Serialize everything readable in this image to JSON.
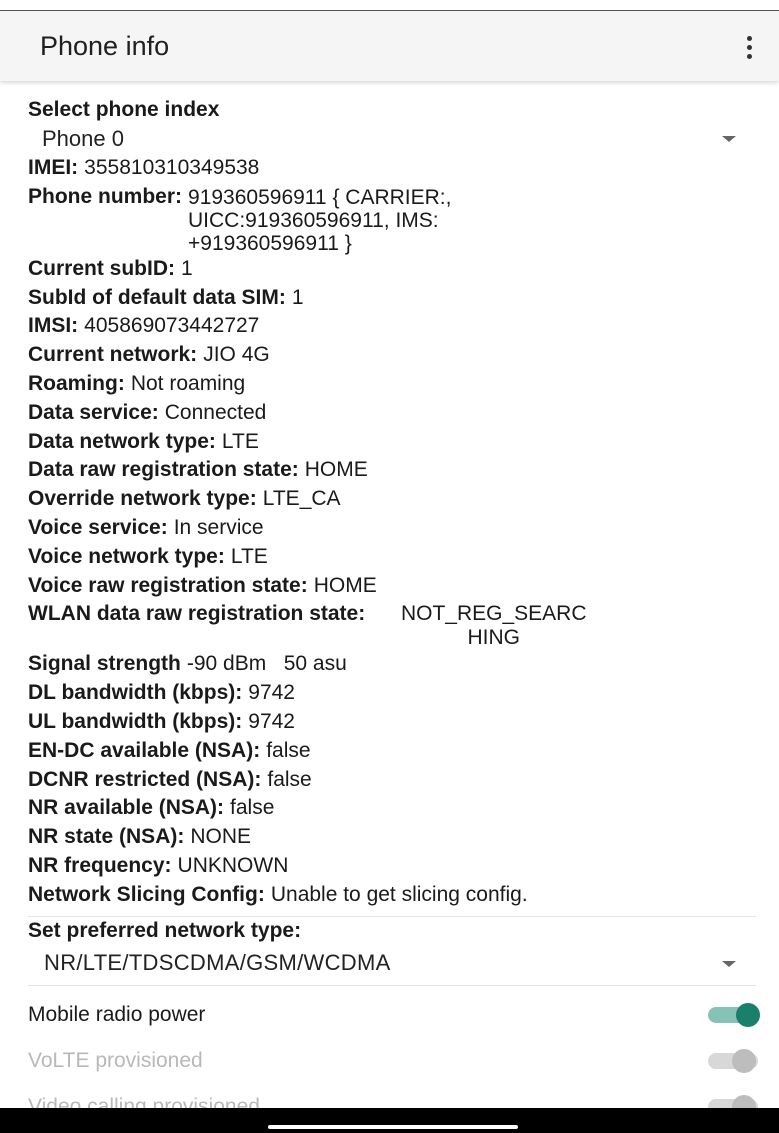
{
  "app_bar": {
    "title": "Phone info",
    "overflow_icon": "more-vert-icon"
  },
  "phone_index": {
    "label": "Select phone index",
    "selected": "Phone 0"
  },
  "info": [
    {
      "key": "IMEI:",
      "value": "355810310349538"
    },
    {
      "key": "Phone number:",
      "value": "919360596911 { CARRIER:,\nUICC:919360596911, IMS:\n+919360596911 }"
    },
    {
      "key": "Current subID:",
      "value": "1"
    },
    {
      "key": "SubId of default data SIM:",
      "value": "1"
    },
    {
      "key": "IMSI:",
      "value": "405869073442727"
    },
    {
      "key": "Current network:",
      "value": "JIO 4G"
    },
    {
      "key": "Roaming:",
      "value": "Not roaming"
    },
    {
      "key": "Data service:",
      "value": "Connected"
    },
    {
      "key": "Data network type:",
      "value": "LTE"
    },
    {
      "key": "Data raw registration state:",
      "value": "HOME"
    },
    {
      "key": "Override network type:",
      "value": "LTE_CA"
    },
    {
      "key": "Voice service:",
      "value": "In service"
    },
    {
      "key": "Voice network type:",
      "value": "LTE"
    },
    {
      "key": "Voice raw registration state:",
      "value": "HOME"
    },
    {
      "key": "WLAN data raw registration state:",
      "value": "NOT_REG_SEARC\nHING"
    },
    {
      "key": "Signal strength",
      "value": "-90 dBm   50 asu"
    },
    {
      "key": "DL bandwidth (kbps):",
      "value": "9742"
    },
    {
      "key": "UL bandwidth (kbps):",
      "value": "9742"
    },
    {
      "key": "EN-DC available (NSA):",
      "value": "false"
    },
    {
      "key": "DCNR restricted (NSA):",
      "value": "false"
    },
    {
      "key": "NR available (NSA):",
      "value": "false"
    },
    {
      "key": "NR state (NSA):",
      "value": "NONE"
    },
    {
      "key": "NR frequency:",
      "value": "UNKNOWN"
    },
    {
      "key": "Network Slicing Config:",
      "value": "Unable to get slicing config."
    }
  ],
  "preferred_network": {
    "label": "Set preferred network type:",
    "selected": "NR/LTE/TDSCDMA/GSM/WCDMA"
  },
  "switches": [
    {
      "label": "Mobile radio power",
      "on": true,
      "enabled": true
    },
    {
      "label": "VoLTE provisioned",
      "on": false,
      "enabled": false
    },
    {
      "label": "Video calling provisioned",
      "on": false,
      "enabled": false
    }
  ],
  "colors": {
    "accent": "#1a7f6b",
    "accent_track": "#86c2b6",
    "disabled_text": "#b8b8b8"
  }
}
